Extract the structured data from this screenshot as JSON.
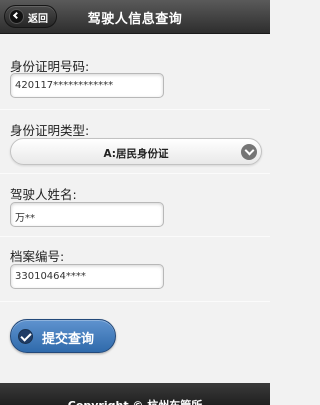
{
  "header": {
    "back_label": "返回",
    "title": "驾驶人信息查询"
  },
  "form": {
    "id_number": {
      "label": "身份证明号码:",
      "value": "420117************"
    },
    "id_type": {
      "label": "身份证明类型:",
      "selected": "A:居民身份证"
    },
    "name": {
      "label": "驾驶人姓名:",
      "value": "万**"
    },
    "file_number": {
      "label": "档案编号:",
      "value": "33010464****"
    },
    "submit_label": "提交查询"
  },
  "footer": {
    "text": "Copyright © 杭州车管所"
  },
  "colors": {
    "topbar": "#2e2e2e",
    "submit_button": "#3a73b5",
    "page_background": "#f2f2f2"
  }
}
